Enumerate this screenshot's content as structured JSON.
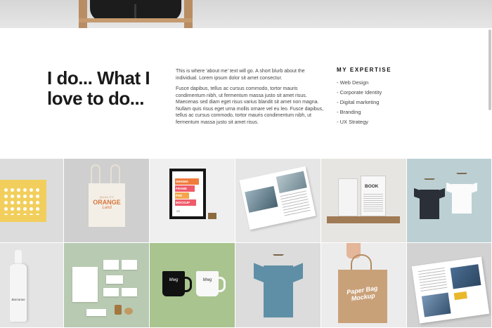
{
  "about": {
    "headline": "I do... What I love to do...",
    "intro": "This is where 'about me' text will go. A short blurb about the individual. Lorem ipsum dolor sit amet consectur.",
    "body": "Fusce dapibus, tellus ac cursus commodo, tortor mauris condimentum nibh, ut fermentum massa justo sit amet risus. Maecenas sed diam eget risus varius blandit sit amet non magna. Nullam quis risus eget urna mollis ornare vel eu leo. Fusce dapibus, tellus ac cursus commodo, tortor mauris condimentum nibh, ut fermentum massa justo sit amet risus."
  },
  "expertise": {
    "title": "MY EXPERTISE",
    "items": [
      "- Web Design",
      "- Corporate Identity",
      "- Digital marketing",
      "- Branding",
      "- UX Strategy"
    ]
  },
  "portfolio": {
    "tote": {
      "l1": "QUALITY",
      "l2": "ORANGE",
      "l3": "Land"
    },
    "frame": {
      "l1": "SHIGMA",
      "l2": "FRAME",
      "l3": "PSD",
      "l4": "MOCKUP",
      "version": "V2"
    },
    "book": {
      "title": "BOOK"
    },
    "bottle": {
      "label": "Barcanas"
    },
    "mug": {
      "logo": "Mwg"
    },
    "bag": {
      "text": "Paper Bag Mockup"
    }
  },
  "colors": {
    "accent_yellow": "#f2cf5c",
    "tote_orange": "#d8753a",
    "frame_orange": "#f07c3c",
    "frame_pink": "#ef5b6a",
    "frame_peach": "#f4a54b"
  }
}
